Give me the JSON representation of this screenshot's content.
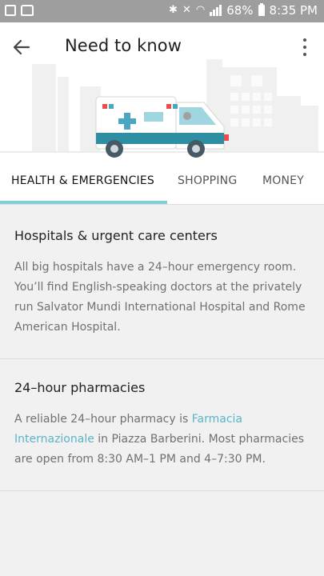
{
  "status_bar": {
    "battery": "68%",
    "time": "8:35 PM"
  },
  "header": {
    "title": "Need to know"
  },
  "tabs": [
    {
      "label": "HEALTH & EMERGENCIES",
      "active": true
    },
    {
      "label": "SHOPPING",
      "active": false
    },
    {
      "label": "MONEY",
      "active": false
    }
  ],
  "sections": [
    {
      "title": "Hospitals & urgent care centers",
      "body": "All big hospitals have a 24–hour emergency room. You’ll find English-speaking doctors at the privately run Salvator Mundi International Hospital and Rome American Hospital."
    },
    {
      "title": "24–hour pharmacies",
      "body_prefix": "A reliable 24–hour pharmacy is ",
      "body_link_1": "Farmacia",
      "body_link_2": "Internazionale",
      "body_suffix": " in Piazza Barberini. Most pharmacies are open from 8:30 AM–1 PM and 4–7:30 PM."
    }
  ],
  "colors": {
    "accent": "#7ecfd9",
    "link": "#5ab4c8",
    "status_bar": "#9e9e9e"
  }
}
